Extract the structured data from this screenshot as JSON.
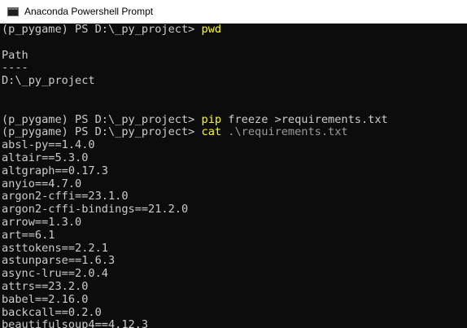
{
  "window": {
    "title": "Anaconda Powershell Prompt"
  },
  "terminal": {
    "background": "#0c0c0c",
    "foreground": "#cccccc",
    "command_color": "#ffff00",
    "lines": [
      {
        "prompt": "(p_pygame) PS D:\\_py_project> ",
        "cmd": "pwd",
        "args": ""
      },
      {
        "text": ""
      },
      {
        "text": "Path"
      },
      {
        "text": "----"
      },
      {
        "text": "D:\\_py_project"
      },
      {
        "text": ""
      },
      {
        "text": ""
      },
      {
        "prompt": "(p_pygame) PS D:\\_py_project> ",
        "cmd": "pip",
        "args": " freeze >requirements.txt"
      },
      {
        "prompt": "(p_pygame) PS D:\\_py_project> ",
        "cmd": "cat",
        "args": " .\\requirements.txt"
      },
      {
        "text": "absl-py==1.4.0"
      },
      {
        "text": "altair==5.3.0"
      },
      {
        "text": "altgraph==0.17.3"
      },
      {
        "text": "anyio==4.7.0"
      },
      {
        "text": "argon2-cffi==23.1.0"
      },
      {
        "text": "argon2-cffi-bindings==21.2.0"
      },
      {
        "text": "arrow==1.3.0"
      },
      {
        "text": "art==6.1"
      },
      {
        "text": "asttokens==2.2.1"
      },
      {
        "text": "astunparse==1.6.3"
      },
      {
        "text": "async-lru==2.0.4"
      },
      {
        "text": "attrs==23.2.0"
      },
      {
        "text": "babel==2.16.0"
      },
      {
        "text": "backcall==0.2.0"
      },
      {
        "text": "beautifulsoup4==4.12.3"
      }
    ]
  }
}
